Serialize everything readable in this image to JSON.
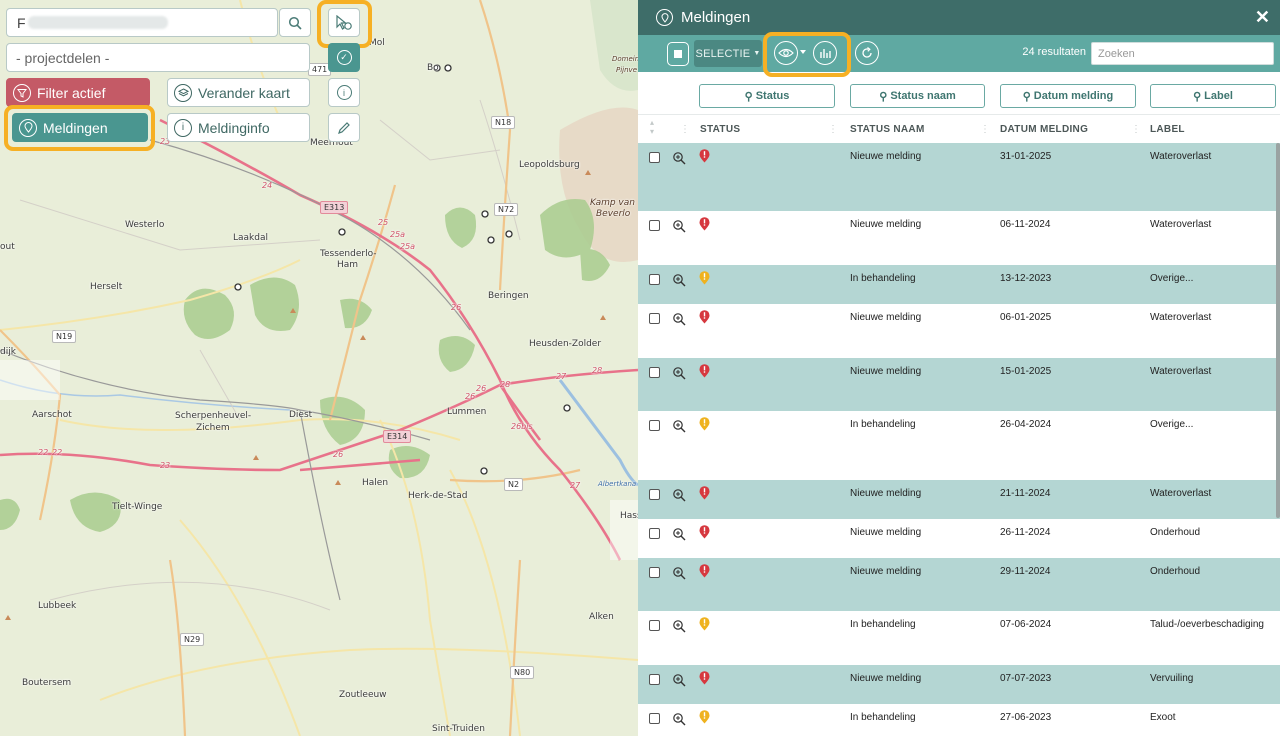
{
  "map": {
    "search_value": "F",
    "project_placeholder": "- projectdelen -",
    "filter_label": "Filter actief",
    "change_map_label": "Verander kaart",
    "meldingen_label": "Meldingen",
    "meldinginfo_label": "Meldinginfo",
    "places": [
      {
        "name": "Mol"
      },
      {
        "name": "Leopoldsburg"
      },
      {
        "name": "Kamp van"
      },
      {
        "name": "Beverlo"
      },
      {
        "name": "Westerlo"
      },
      {
        "name": "Laakdal"
      },
      {
        "name": "Tessenderlo-"
      },
      {
        "name": "Ham"
      },
      {
        "name": "Herselt"
      },
      {
        "name": "Beringen"
      },
      {
        "name": "Heusden-Zolder"
      },
      {
        "name": "Aarschot"
      },
      {
        "name": "Scherpenheuvel-"
      },
      {
        "name": "Zichem"
      },
      {
        "name": "Diest"
      },
      {
        "name": "Lummen"
      },
      {
        "name": "Halen"
      },
      {
        "name": "Herk-de-Stad"
      },
      {
        "name": "Tielt-Winge"
      },
      {
        "name": "Lubbeek"
      },
      {
        "name": "Boutersem"
      },
      {
        "name": "Zoutleeuw"
      },
      {
        "name": "Sint-Truiden"
      },
      {
        "name": "Alken"
      },
      {
        "name": "Meerhout"
      },
      {
        "name": "Hass"
      },
      {
        "name": "Albertkana"
      },
      {
        "name": "out"
      },
      {
        "name": "dijk"
      },
      {
        "name": "Domein"
      },
      {
        "name": "Pijnve"
      },
      {
        "name": "Bo"
      }
    ],
    "roads": [
      "N18",
      "E313",
      "N72",
      "N19",
      "E314",
      "N2",
      "N29",
      "N80",
      "471"
    ],
    "road_numbers": [
      "23",
      "24",
      "25",
      "25a",
      "25a",
      "26",
      "26",
      "26",
      "26",
      "27",
      "27",
      "28",
      "28",
      "26bis",
      "22",
      "22",
      "23"
    ]
  },
  "panel": {
    "title": "Meldingen",
    "close_symbol": "✕",
    "selectie_label": "SELECTIE",
    "results_text": "24 resultaten",
    "search_placeholder": "Zoeken",
    "filter_buttons": [
      "Status",
      "Status naam",
      "Datum melding",
      "Label"
    ],
    "columns": [
      "STATUS",
      "STATUS NAAM",
      "DATUM MELDING",
      "LABEL"
    ],
    "colors": {
      "header": "#3e6d69",
      "toolbar": "#5fa9a2",
      "row_alt": "#b4d6d3",
      "status_new": "#d6383f",
      "status_progress": "#efb21f",
      "highlight": "#f6b024"
    },
    "rows": [
      {
        "status": "new",
        "status_naam": "Nieuwe melding",
        "datum": "31-01-2025",
        "label": "Wateroverlast"
      },
      {
        "status": "new",
        "status_naam": "Nieuwe melding",
        "datum": "06-11-2024",
        "label": "Wateroverlast"
      },
      {
        "status": "progress",
        "status_naam": "In behandeling",
        "datum": "13-12-2023",
        "label": "Overige..."
      },
      {
        "status": "new",
        "status_naam": "Nieuwe melding",
        "datum": "06-01-2025",
        "label": "Wateroverlast"
      },
      {
        "status": "new",
        "status_naam": "Nieuwe melding",
        "datum": "15-01-2025",
        "label": "Wateroverlast"
      },
      {
        "status": "progress",
        "status_naam": "In behandeling",
        "datum": "26-04-2024",
        "label": "Overige..."
      },
      {
        "status": "new",
        "status_naam": "Nieuwe melding",
        "datum": "21-11-2024",
        "label": "Wateroverlast"
      },
      {
        "status": "new",
        "status_naam": "Nieuwe melding",
        "datum": "26-11-2024",
        "label": "Onderhoud"
      },
      {
        "status": "new",
        "status_naam": "Nieuwe melding",
        "datum": "29-11-2024",
        "label": "Onderhoud"
      },
      {
        "status": "progress",
        "status_naam": "In behandeling",
        "datum": "07-06-2024",
        "label": "Talud-/oeverbeschadiging"
      },
      {
        "status": "new",
        "status_naam": "Nieuwe melding",
        "datum": "07-07-2023",
        "label": "Vervuiling"
      },
      {
        "status": "progress",
        "status_naam": "In behandeling",
        "datum": "27-06-2023",
        "label": "Exoot"
      }
    ]
  }
}
